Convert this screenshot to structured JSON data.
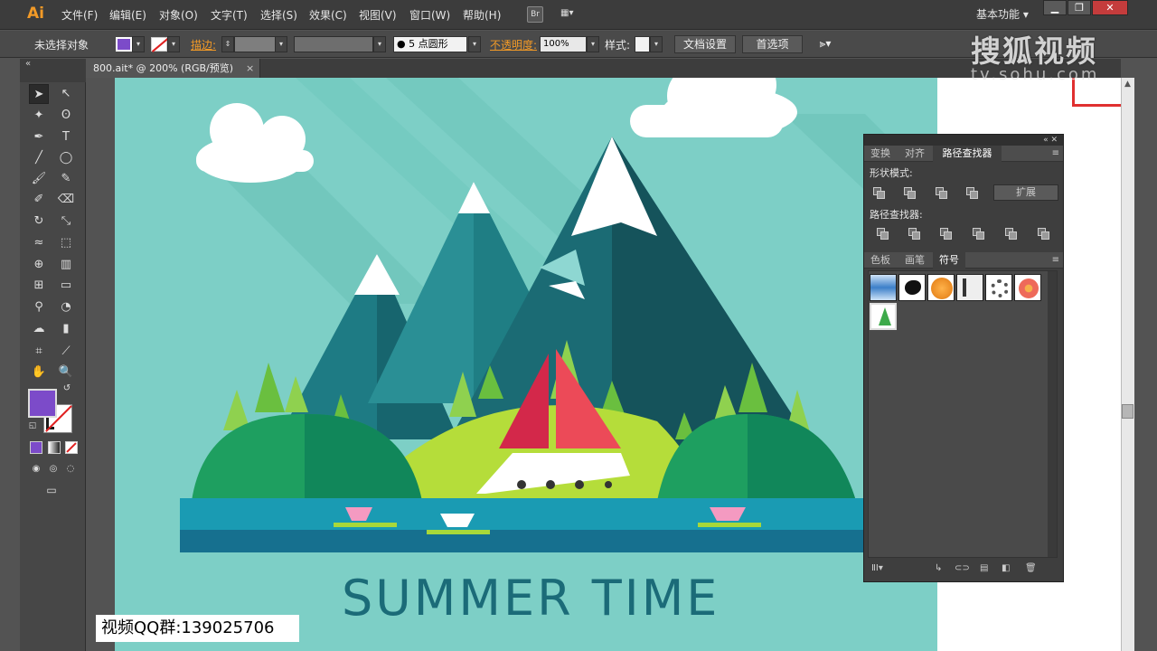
{
  "app": {
    "logo": "Ai"
  },
  "menus": [
    "文件(F)",
    "编辑(E)",
    "对象(O)",
    "文字(T)",
    "选择(S)",
    "效果(C)",
    "视图(V)",
    "窗口(W)",
    "帮助(H)"
  ],
  "bridge_label": "Br",
  "workspace": "基本功能",
  "window_buttons": {
    "minimize": "▁",
    "restore": "❐",
    "close": "✕"
  },
  "control": {
    "selection": "未选择对象",
    "stroke_label": "描边:",
    "stroke_value": "",
    "brush": "● 5 点圆形",
    "opacity_label": "不透明度:",
    "opacity_value": "100%",
    "style_label": "样式:",
    "doc_setup": "文档设置",
    "preferences": "首选项"
  },
  "document_tab": {
    "title": "800.ait* @ 200% (RGB/预览)",
    "close": "×"
  },
  "toolbar": {
    "collapse": "«"
  },
  "colors": {
    "fill": "#7c4bc9",
    "stroke": "none",
    "sky": "#7dcfc6",
    "title_text": "#1b6b78"
  },
  "panel": {
    "collapse": "«  ✕",
    "tabs_top": [
      "变换",
      "对齐",
      "路径查找器"
    ],
    "active_top": "路径查找器",
    "shape_modes": "形状模式:",
    "expand": "扩展",
    "pathfinders": "路径查找器:",
    "tabs_bottom": [
      "色板",
      "画笔",
      "符号"
    ],
    "active_bottom": "符号",
    "menu_icon": "≡",
    "symbols": [
      "blue-banner",
      "ink-splash",
      "orange-ball",
      "grunge-bar",
      "chain-ring",
      "flower",
      "tree"
    ],
    "footer_libs": "ⅡⅠ▾"
  },
  "artwork": {
    "title": "SUMMER TIME"
  },
  "watermark": {
    "brand": "搜狐视频",
    "url": "tv.sohu.com"
  },
  "overlay": {
    "qq": "视频QQ群:139025706"
  }
}
